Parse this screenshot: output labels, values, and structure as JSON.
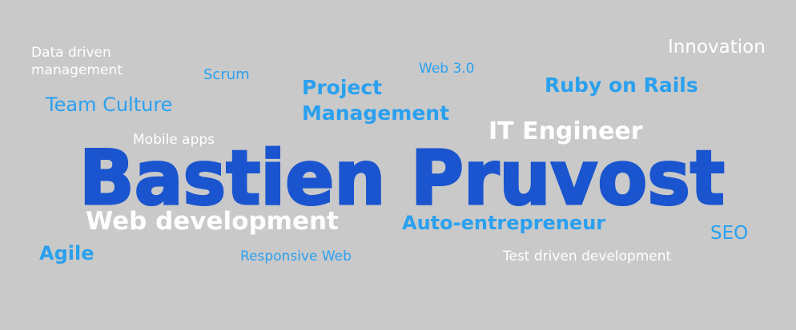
{
  "banner": {
    "name": "Bastien Pruvost",
    "colors": {
      "background": "#c9c9c9",
      "white_text": "#ffffff",
      "blue_text": "#2aa0ef",
      "name_fill": "#1a55cf"
    },
    "keywords": {
      "data_driven_line1": "Data driven",
      "data_driven_line2": "management",
      "scrum": "Scrum",
      "project_line1": "Project",
      "project_line2": "Management",
      "web3": "Web 3.0",
      "ruby": "Ruby on Rails",
      "innovation": "Innovation",
      "team_culture": "Team Culture",
      "mobile_apps": "Mobile apps",
      "it_engineer": "IT Engineer",
      "web_development": "Web development",
      "auto_entrepreneur": "Auto-entrepreneur",
      "seo": "SEO",
      "agile": "Agile",
      "responsive_web": "Responsive Web",
      "tdd": "Test driven development"
    }
  }
}
